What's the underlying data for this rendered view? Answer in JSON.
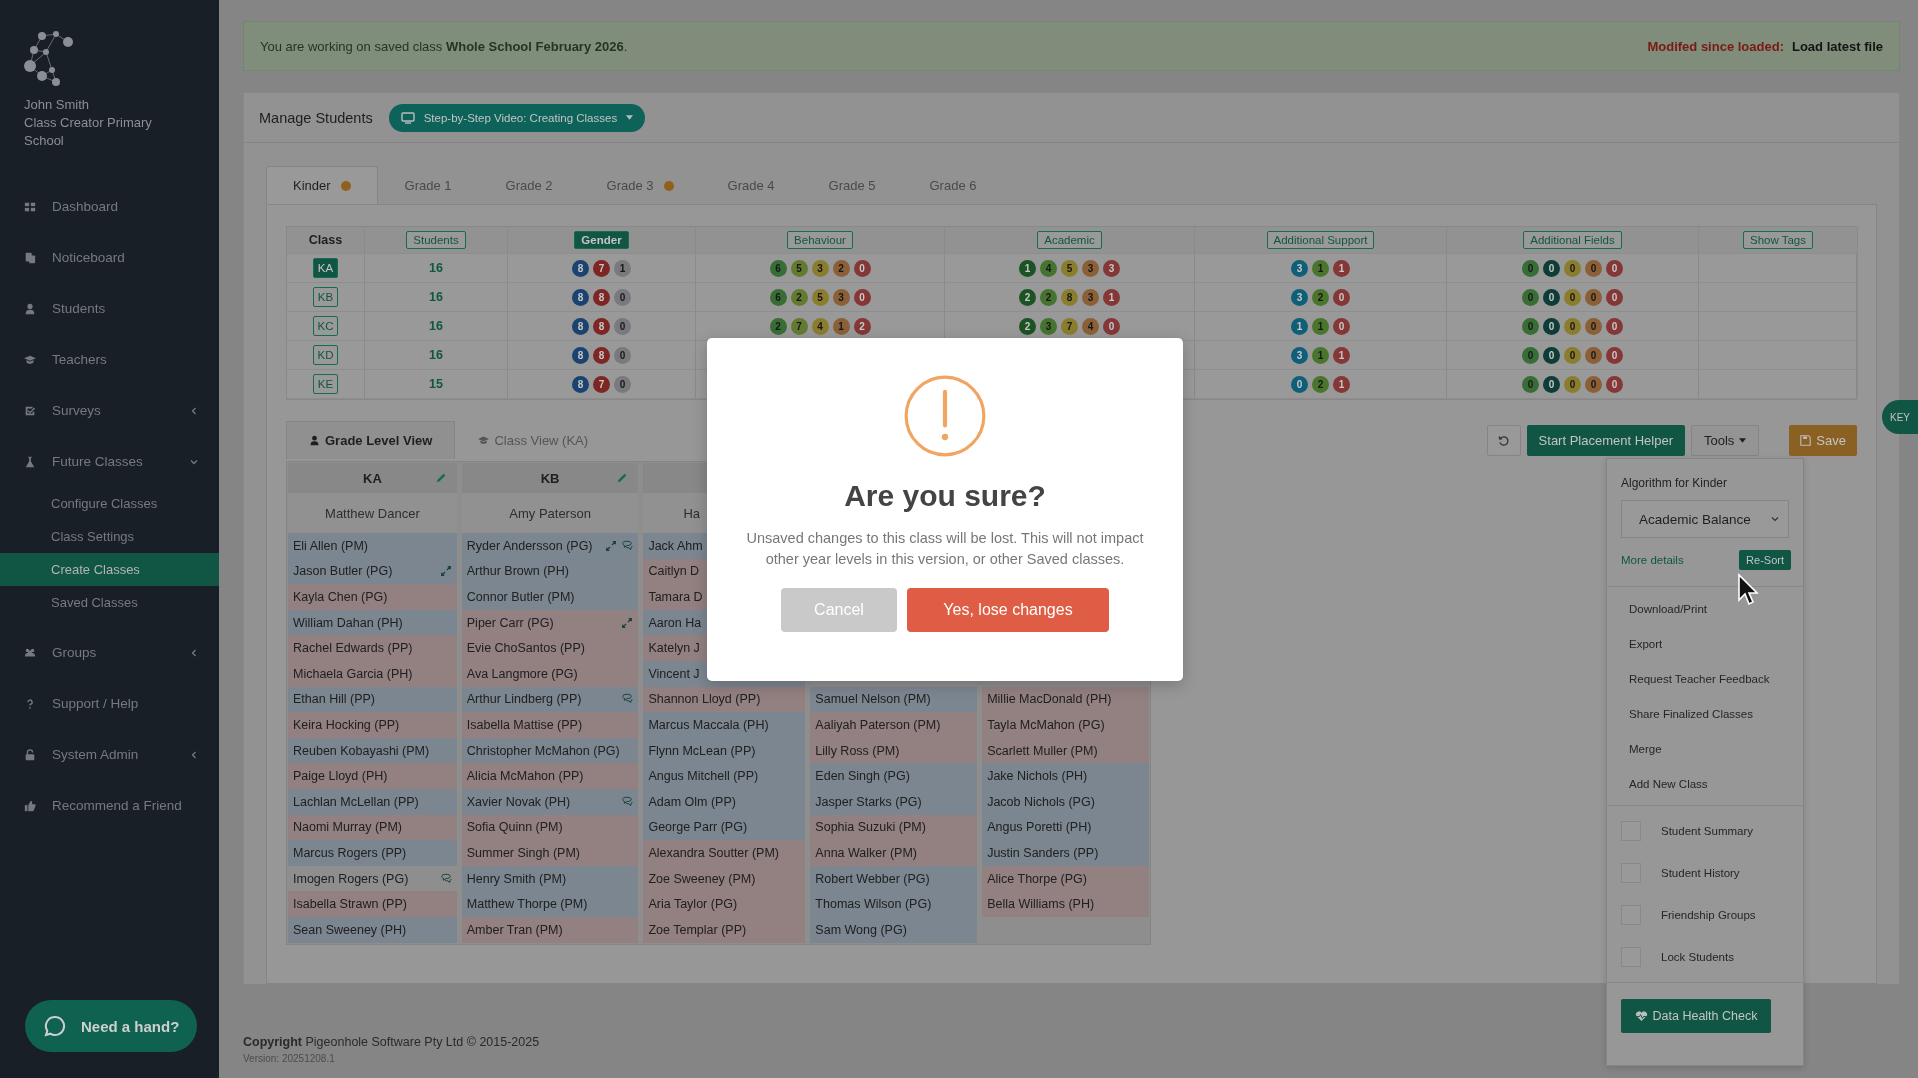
{
  "sidebar": {
    "user_name": "John Smith",
    "school": "Class Creator Primary School",
    "items": [
      {
        "label": "Dashboard",
        "selected": false
      },
      {
        "label": "Noticeboard",
        "selected": false
      },
      {
        "label": "Students",
        "selected": false
      },
      {
        "label": "Teachers",
        "selected": false
      },
      {
        "label": "Surveys",
        "selected": false,
        "expanded": false
      },
      {
        "label": "Future Classes",
        "selected": false,
        "expanded": true,
        "children": [
          {
            "label": "Configure Classes",
            "selected": false
          },
          {
            "label": "Class Settings",
            "selected": false
          },
          {
            "label": "Create Classes",
            "selected": true
          },
          {
            "label": "Saved Classes",
            "selected": false
          }
        ]
      },
      {
        "label": "Groups",
        "selected": false,
        "expanded": false
      },
      {
        "label": "Support / Help",
        "selected": false
      },
      {
        "label": "System Admin",
        "selected": false,
        "expanded": false
      },
      {
        "label": "Recommend a Friend",
        "selected": false
      }
    ],
    "help_button": "Need a hand?"
  },
  "banner": {
    "text": "You are working on saved class **Whole School February 2026**.",
    "status": "Modifed since loaded:",
    "link": "Load latest file"
  },
  "header": {
    "title": "Manage Students",
    "video_button": "Step-by-Step Video: Creating Classes"
  },
  "grade_tabs": [
    {
      "label": "Kinder",
      "selected": true,
      "flagged": true
    },
    {
      "label": "Grade 1",
      "selected": false,
      "flagged": false
    },
    {
      "label": "Grade 2",
      "selected": false,
      "flagged": false
    },
    {
      "label": "Grade 3",
      "selected": false,
      "flagged": true
    },
    {
      "label": "Grade 4",
      "selected": false,
      "flagged": false
    },
    {
      "label": "Grade 5",
      "selected": false,
      "flagged": false
    },
    {
      "label": "Grade 6",
      "selected": false,
      "flagged": false
    }
  ],
  "summary": {
    "columns": [
      {
        "label": "Class",
        "kind": "text"
      },
      {
        "label": "Students",
        "kind": "button",
        "selected": false
      },
      {
        "label": "Gender",
        "kind": "button",
        "selected": true
      },
      {
        "label": "Behaviour",
        "kind": "button",
        "selected": false
      },
      {
        "label": "Academic",
        "kind": "button",
        "selected": false
      },
      {
        "label": "Additional Support",
        "kind": "button",
        "selected": false
      },
      {
        "label": "Additional Fields",
        "kind": "button",
        "selected": false
      },
      {
        "label": "Show Tags",
        "kind": "button",
        "selected": false
      }
    ],
    "pill_legend": {
      "gender": [
        {
          "color": "#1a4370"
        },
        {
          "color": "#7e2623"
        },
        {
          "color": "#787a7d"
        }
      ],
      "behaviour": [
        {
          "color": "#386e36"
        },
        {
          "color": "#657a31"
        },
        {
          "color": "#8a7d2e"
        },
        {
          "color": "#8c6037"
        },
        {
          "color": "#853737"
        }
      ],
      "academic": [
        {
          "color": "#1c5324"
        },
        {
          "color": "#46732f"
        },
        {
          "color": "#8a7d2e"
        },
        {
          "color": "#8c6037"
        },
        {
          "color": "#853737"
        }
      ],
      "support": [
        {
          "color": "#105f79"
        },
        {
          "color": "#4a752c"
        },
        {
          "color": "#853737"
        }
      ],
      "fields": [
        {
          "color": "#386e36"
        },
        {
          "color": "#0e3c36"
        },
        {
          "color": "#8a7d2e"
        },
        {
          "color": "#8c6037"
        },
        {
          "color": "#853737"
        }
      ]
    },
    "rows": [
      {
        "class": "KA",
        "selected": true,
        "students": "16",
        "gender": [
          "8",
          "7",
          "1"
        ],
        "behaviour": [
          "6",
          "5",
          "3",
          "2",
          "0"
        ],
        "academic": [
          "1",
          "4",
          "5",
          "3",
          "3"
        ],
        "support": [
          "3",
          "1",
          "1"
        ],
        "fields": [
          "0",
          "0",
          "0",
          "0",
          "0"
        ]
      },
      {
        "class": "KB",
        "selected": false,
        "students": "16",
        "gender": [
          "8",
          "8",
          "0"
        ],
        "behaviour": [
          "6",
          "2",
          "5",
          "3",
          "0"
        ],
        "academic": [
          "2",
          "2",
          "8",
          "3",
          "1"
        ],
        "support": [
          "3",
          "2",
          "0"
        ],
        "fields": [
          "0",
          "0",
          "0",
          "0",
          "0"
        ]
      },
      {
        "class": "KC",
        "selected": false,
        "students": "16",
        "gender": [
          "8",
          "8",
          "0"
        ],
        "behaviour": [
          "2",
          "7",
          "4",
          "1",
          "2"
        ],
        "academic": [
          "2",
          "3",
          "7",
          "4",
          "0"
        ],
        "support": [
          "1",
          "1",
          "0"
        ],
        "fields": [
          "0",
          "0",
          "0",
          "0",
          "0"
        ]
      },
      {
        "class": "KD",
        "selected": false,
        "students": "16",
        "gender": [
          "8",
          "8",
          "0"
        ],
        "support": [
          "3",
          "1",
          "1"
        ],
        "fields": [
          "0",
          "0",
          "0",
          "0",
          "0"
        ]
      },
      {
        "class": "KE",
        "selected": false,
        "students": "15",
        "gender": [
          "8",
          "7",
          "0"
        ],
        "support": [
          "0",
          "2",
          "1"
        ],
        "fields": [
          "0",
          "0",
          "0",
          "0",
          "0"
        ]
      }
    ]
  },
  "list_tabs": [
    {
      "label": "Grade Level View",
      "selected": true
    },
    {
      "label": "Class View (KA)",
      "selected": false
    }
  ],
  "toolbar": {
    "helper_button": "Start Placement Helper",
    "tools_button": "Tools",
    "save_button": "Save"
  },
  "key_tab": "KEY",
  "class_lists": [
    {
      "class": "KA",
      "teacher": "Matthew Dancer",
      "students": [
        {
          "name": "Eli Allen (PM)",
          "color": "#7c8691"
        },
        {
          "name": "Jason Butler (PG)",
          "color": "#7c8691",
          "icons": [
            {
              "kind": "arrows"
            }
          ]
        },
        {
          "name": "Kayla Chen (PG)",
          "color": "#938081"
        },
        {
          "name": "William Dahan (PH)",
          "color": "#7c8691"
        },
        {
          "name": "Rachel Edwards (PP)",
          "color": "#938081"
        },
        {
          "name": "Michaela Garcia (PH)",
          "color": "#938081"
        },
        {
          "name": "Ethan Hill (PP)",
          "color": "#7c8691"
        },
        {
          "name": "Keira Hocking (PP)",
          "color": "#938081"
        },
        {
          "name": "Reuben Kobayashi (PM)",
          "color": "#7c8691"
        },
        {
          "name": "Paige Lloyd (PH)",
          "color": "#938081"
        },
        {
          "name": "Lachlan McLellan (PP)",
          "color": "#7c8691"
        },
        {
          "name": "Naomi Murray (PM)",
          "color": "#938081"
        },
        {
          "name": "Marcus Rogers (PP)",
          "color": "#7c8691"
        },
        {
          "name": "Imogen Rogers (PG)",
          "color": "#8e8e8e",
          "icons": [
            {
              "kind": "comment"
            }
          ]
        },
        {
          "name": "Isabella Strawn (PP)",
          "color": "#938081"
        },
        {
          "name": "Sean Sweeney (PH)",
          "color": "#7c8691"
        }
      ]
    },
    {
      "class": "KB",
      "teacher": "Amy Paterson",
      "students": [
        {
          "name": "Ryder Andersson (PG)",
          "color": "#7c8691",
          "icons": [
            {
              "kind": "arrows"
            },
            {
              "kind": "comment"
            }
          ]
        },
        {
          "name": "Arthur Brown (PH)",
          "color": "#7c8691"
        },
        {
          "name": "Connor Butler (PM)",
          "color": "#7c8691"
        },
        {
          "name": "Piper Carr (PG)",
          "color": "#938081",
          "icons": [
            {
              "kind": "arrows"
            }
          ]
        },
        {
          "name": "Evie ChoSantos (PP)",
          "color": "#938081"
        },
        {
          "name": "Ava Langmore (PG)",
          "color": "#938081"
        },
        {
          "name": "Arthur Lindberg (PP)",
          "color": "#7c8691",
          "icons": [
            {
              "kind": "comment"
            }
          ]
        },
        {
          "name": "Isabella Mattise (PP)",
          "color": "#938081"
        },
        {
          "name": "Christopher McMahon (PG)",
          "color": "#7c8691"
        },
        {
          "name": "Alicia McMahon (PP)",
          "color": "#938081"
        },
        {
          "name": "Xavier Novak (PH)",
          "color": "#7c8691",
          "icons": [
            {
              "kind": "comment"
            }
          ]
        },
        {
          "name": "Sofia Quinn (PM)",
          "color": "#938081"
        },
        {
          "name": "Summer Singh (PM)",
          "color": "#938081"
        },
        {
          "name": "Henry Smith (PM)",
          "color": "#7c8691"
        },
        {
          "name": "Matthew Thorpe (PM)",
          "color": "#7c8691"
        },
        {
          "name": "Amber Tran (PM)",
          "color": "#938081"
        }
      ]
    },
    {
      "teacher": "Ha",
      "students": [
        {
          "name": "Jack Ahm",
          "color": "#7c8691"
        },
        {
          "name": "Caitlyn D",
          "color": "#938081"
        },
        {
          "name": "Tamara D",
          "color": "#938081"
        },
        {
          "name": "Aaron Ha",
          "color": "#7c8691"
        },
        {
          "name": "Katelyn J",
          "color": "#938081"
        },
        {
          "name": "Vincent J",
          "color": "#7c8691"
        },
        {
          "name": "Shannon Lloyd (PP)",
          "color": "#938081"
        },
        {
          "name": "Marcus Maccala (PH)",
          "color": "#7c8691"
        },
        {
          "name": "Flynn McLean (PP)",
          "color": "#7c8691"
        },
        {
          "name": "Angus Mitchell (PP)",
          "color": "#7c8691"
        },
        {
          "name": "Adam Olm (PP)",
          "color": "#7c8691"
        },
        {
          "name": "George Parr (PG)",
          "color": "#7c8691"
        },
        {
          "name": "Alexandra Soutter (PM)",
          "color": "#938081"
        },
        {
          "name": "Zoe Sweeney (PM)",
          "color": "#938081"
        },
        {
          "name": "Aria Taylor (PG)",
          "color": "#938081"
        },
        {
          "name": "Zoe Templar (PP)",
          "color": "#938081"
        }
      ]
    },
    {
      "students": [
        {
          "name": "Samuel Nelson (PM)",
          "color": "#7c8691"
        },
        {
          "name": "Aaliyah Paterson (PM)",
          "color": "#938081"
        },
        {
          "name": "Lilly Ross (PM)",
          "color": "#938081"
        },
        {
          "name": "Eden Singh (PG)",
          "color": "#7c8691"
        },
        {
          "name": "Jasper Starks (PG)",
          "color": "#7c8691"
        },
        {
          "name": "Sophia Suzuki (PM)",
          "color": "#938081"
        },
        {
          "name": "Anna Walker (PM)",
          "color": "#938081"
        },
        {
          "name": "Robert Webber (PG)",
          "color": "#7c8691"
        },
        {
          "name": "Thomas Wilson (PG)",
          "color": "#7c8691"
        },
        {
          "name": "Sam Wong (PG)",
          "color": "#7c8691"
        }
      ]
    },
    {
      "students": [
        {
          "name": "Millie MacDonald (PH)",
          "color": "#938081"
        },
        {
          "name": "Tayla McMahon (PG)",
          "color": "#938081"
        },
        {
          "name": "Scarlett Muller (PM)",
          "color": "#938081"
        },
        {
          "name": "Jake Nichols (PH)",
          "color": "#7c8691"
        },
        {
          "name": "Jacob Nichols (PG)",
          "color": "#7c8691"
        },
        {
          "name": "Angus Poretti (PH)",
          "color": "#7c8691"
        },
        {
          "name": "Justin Sanders (PP)",
          "color": "#7c8691"
        },
        {
          "name": "Alice Thorpe (PG)",
          "color": "#938081"
        },
        {
          "name": "Bella Williams (PH)",
          "color": "#938081"
        }
      ]
    }
  ],
  "tools_menu": {
    "algorithm_label": "Algorithm for Kinder",
    "algorithm": "Academic Balance",
    "details_link": "More details",
    "resort_button": "Re-Sort",
    "actions": [
      "Download/Print",
      "Export",
      "Request Teacher Feedback",
      "Share Finalized Classes",
      "Merge",
      "Add New Class"
    ],
    "toggles": [
      {
        "label": "Student Summary",
        "checked": false
      },
      {
        "label": "Student History",
        "checked": false
      },
      {
        "label": "Friendship Groups",
        "checked": false
      },
      {
        "label": "Lock Students",
        "checked": false
      }
    ],
    "health_button": "Data Health Check"
  },
  "modal": {
    "title": "Are you sure?",
    "message": "Unsaved changes to this class will be lost. This will not impact other year levels in this version, or other Saved classes.",
    "cancel": "Cancel",
    "confirm": "Yes, lose changes"
  },
  "footer": {
    "copyright": "**Copyright** Pigeonhole Software Pty Ltd © 2015-2025",
    "version": "Version: 20251208.1"
  }
}
